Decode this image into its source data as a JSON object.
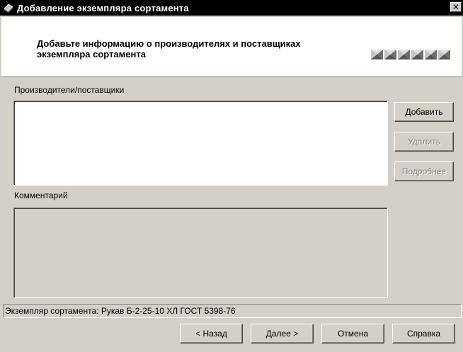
{
  "window": {
    "title": "Добавление экземпляра сортамента",
    "close_glyph": "✕"
  },
  "header": {
    "line1": "Добавьте информацию о производителях и поставщиках",
    "line2": "экземпляра сортамента",
    "step_count": 6
  },
  "producers": {
    "label": "Производители/поставщики",
    "items": []
  },
  "side_buttons": {
    "add": "Добавить",
    "delete": "Удалить",
    "details": "Подробнее"
  },
  "comment": {
    "label": "Комментарий",
    "value": ""
  },
  "status": {
    "text": "Экземпляр сортамента: Рукав Б-2-25-10 ХЛ ГОСТ 5398-76"
  },
  "footer": {
    "back": "< Назад",
    "next": "Далее >",
    "cancel": "Отмена",
    "help": "Справка"
  },
  "colors": {
    "window_bg": "#d4d0c8",
    "titlebar_bg": "#000000",
    "header_bg": "#ffffff"
  }
}
